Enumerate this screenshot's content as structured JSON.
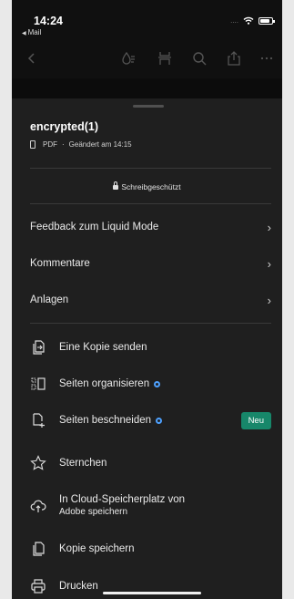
{
  "status_bar": {
    "time": "14:24",
    "back_app": "Mail",
    "signal_dots": "...."
  },
  "document": {
    "title": "encrypted(1)",
    "type": "PDF",
    "separator": "·",
    "modified": "Geändert am 14:15",
    "readonly_label": "Schreibgeschützt"
  },
  "nav_items": [
    {
      "label": "Feedback zum Liquid Mode",
      "chevron": "›"
    },
    {
      "label": "Kommentare",
      "chevron": "›"
    },
    {
      "label": "Anlagen",
      "chevron": "›"
    }
  ],
  "menu_items": [
    {
      "label": "Eine Kopie senden",
      "icon": "send-copy-icon"
    },
    {
      "label": "Seiten organisieren",
      "icon": "organize-pages-icon",
      "dot": true
    },
    {
      "label": "Seiten beschneiden",
      "icon": "crop-pages-icon",
      "dot": true,
      "badge": "Neu"
    },
    {
      "label": "Sternchen",
      "icon": "star-icon"
    },
    {
      "label": "In Cloud-Speicherplatz von",
      "label_line2": "Adobe speichern",
      "icon": "cloud-upload-icon"
    },
    {
      "label": "Kopie speichern",
      "icon": "save-copy-icon"
    },
    {
      "label": "Drucken",
      "icon": "printer-icon"
    }
  ],
  "colors": {
    "accent_dot": "#4ea1ff",
    "badge_green": "#17876a",
    "sheet_bg": "#1f1f1f"
  }
}
